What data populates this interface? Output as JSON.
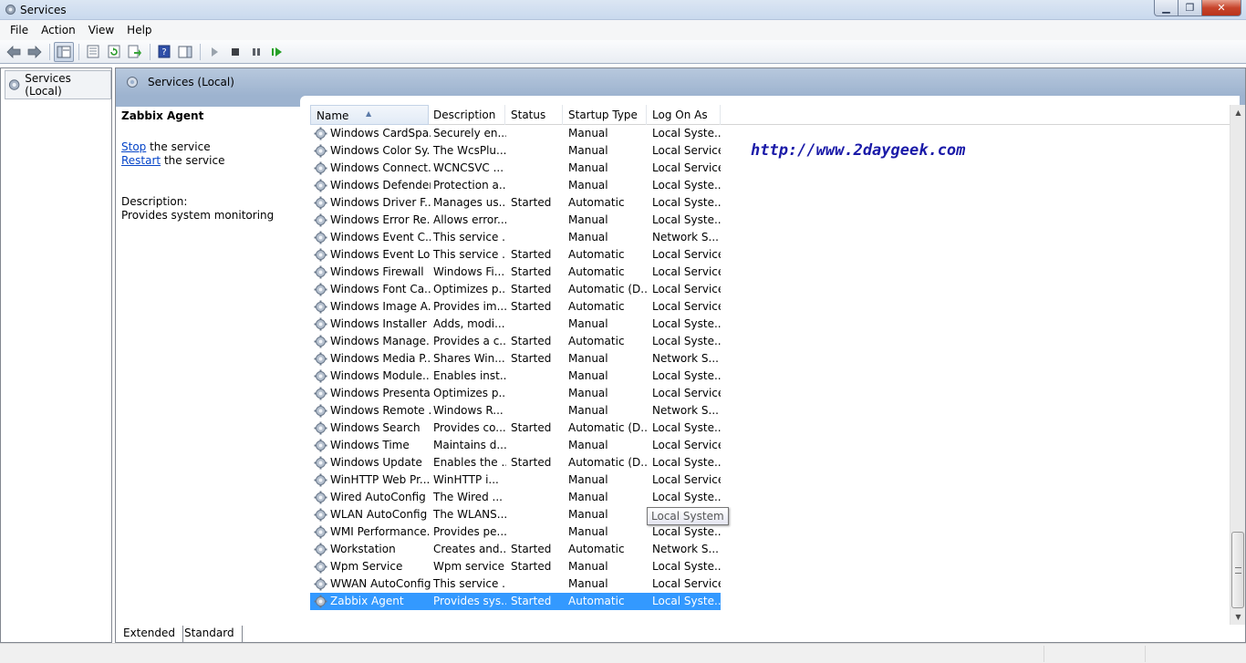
{
  "window": {
    "title": "Services"
  },
  "menu": [
    "File",
    "Action",
    "View",
    "Help"
  ],
  "toolbar": {
    "icons": [
      "back-icon",
      "forward-icon",
      "show-hide-console-tree-icon",
      "properties-icon",
      "refresh-icon",
      "export-list-icon",
      "help-icon",
      "show-hide-action-pane-icon",
      "start-service-icon",
      "stop-service-icon",
      "pause-service-icon",
      "restart-service-icon"
    ]
  },
  "tree": {
    "root_label": "Services (Local)"
  },
  "pane": {
    "header_title": "Services (Local)"
  },
  "details": {
    "service_name": "Zabbix Agent",
    "stop_link": "Stop",
    "stop_suffix": " the service",
    "restart_link": "Restart",
    "restart_suffix": " the service",
    "description_label": "Description:",
    "description_text": "Provides system monitoring"
  },
  "list": {
    "columns": [
      "Name",
      "Description",
      "Status",
      "Startup Type",
      "Log On As"
    ],
    "rows": [
      [
        "Windows CardSpa...",
        "Securely en...",
        "",
        "Manual",
        "Local Syste..."
      ],
      [
        "Windows Color Sy...",
        "The WcsPlu...",
        "",
        "Manual",
        "Local Service"
      ],
      [
        "Windows Connect...",
        "WCNCSVC ...",
        "",
        "Manual",
        "Local Service"
      ],
      [
        "Windows Defender",
        "Protection a...",
        "",
        "Manual",
        "Local Syste..."
      ],
      [
        "Windows Driver F...",
        "Manages us...",
        "Started",
        "Automatic",
        "Local Syste..."
      ],
      [
        "Windows Error Re...",
        "Allows error...",
        "",
        "Manual",
        "Local Syste..."
      ],
      [
        "Windows Event C...",
        "This service ...",
        "",
        "Manual",
        "Network S..."
      ],
      [
        "Windows Event Log",
        "This service ...",
        "Started",
        "Automatic",
        "Local Service"
      ],
      [
        "Windows Firewall",
        "Windows Fi...",
        "Started",
        "Automatic",
        "Local Service"
      ],
      [
        "Windows Font Ca...",
        "Optimizes p...",
        "Started",
        "Automatic (D...",
        "Local Service"
      ],
      [
        "Windows Image A...",
        "Provides im...",
        "Started",
        "Automatic",
        "Local Service"
      ],
      [
        "Windows Installer",
        "Adds, modi...",
        "",
        "Manual",
        "Local Syste..."
      ],
      [
        "Windows Manage...",
        "Provides a c...",
        "Started",
        "Automatic",
        "Local Syste..."
      ],
      [
        "Windows Media P...",
        "Shares Win...",
        "Started",
        "Manual",
        "Network S..."
      ],
      [
        "Windows Module...",
        "Enables inst...",
        "",
        "Manual",
        "Local Syste..."
      ],
      [
        "Windows Presenta...",
        "Optimizes p...",
        "",
        "Manual",
        "Local Service"
      ],
      [
        "Windows Remote ...",
        "Windows R...",
        "",
        "Manual",
        "Network S..."
      ],
      [
        "Windows Search",
        "Provides co...",
        "Started",
        "Automatic (D...",
        "Local Syste..."
      ],
      [
        "Windows Time",
        "Maintains d...",
        "",
        "Manual",
        "Local Service"
      ],
      [
        "Windows Update",
        "Enables the ...",
        "Started",
        "Automatic (D...",
        "Local Syste..."
      ],
      [
        "WinHTTP Web Pr...",
        "WinHTTP i...",
        "",
        "Manual",
        "Local Service"
      ],
      [
        "Wired AutoConfig",
        "The Wired ...",
        "",
        "Manual",
        "Local Syste..."
      ],
      [
        "WLAN AutoConfig",
        "The WLANS...",
        "",
        "Manual",
        "Local Syste..."
      ],
      [
        "WMI Performance...",
        "Provides pe...",
        "",
        "Manual",
        "Local Syste..."
      ],
      [
        "Workstation",
        "Creates and...",
        "Started",
        "Automatic",
        "Network S..."
      ],
      [
        "Wpm Service",
        "Wpm service",
        "Started",
        "Manual",
        "Local Syste..."
      ],
      [
        "WWAN AutoConfig",
        "This service ...",
        "",
        "Manual",
        "Local Service"
      ],
      [
        "Zabbix Agent",
        "Provides sys...",
        "Started",
        "Automatic",
        "Local Syste..."
      ]
    ],
    "selected_row": "Zabbix Agent"
  },
  "tooltip": {
    "text": "Local System"
  },
  "watermark": "http://www.2daygeek.com",
  "tabs": [
    "Extended",
    "Standard"
  ],
  "active_tab": "Extended",
  "colors": {
    "selection": "#3399ff",
    "link": "#0645c8",
    "header_bg": "#9db3cf"
  }
}
